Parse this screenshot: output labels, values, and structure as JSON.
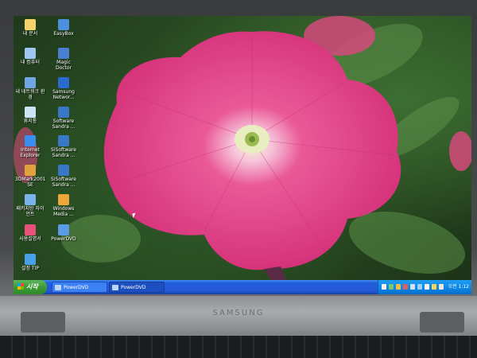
{
  "device": {
    "brand": "SAMSUNG"
  },
  "desktop": {
    "icons": [
      {
        "label": "내 문서",
        "icon": "my-documents-icon",
        "color": "#f5d36a"
      },
      {
        "label": "EasyBox",
        "icon": "easybox-icon",
        "color": "#4f8fe0"
      },
      {
        "label": "내 컴퓨터",
        "icon": "my-computer-icon",
        "color": "#9ec6f0"
      },
      {
        "label": "Magic Doctor",
        "icon": "magic-doctor-icon",
        "color": "#4a7fd2"
      },
      {
        "label": "내 네트워크 환경",
        "icon": "network-places-icon",
        "color": "#6fa7e6"
      },
      {
        "label": "Samsung Networ...",
        "icon": "samsung-network-icon",
        "color": "#2a6bd1"
      },
      {
        "label": "휴지통",
        "icon": "recycle-bin-icon",
        "color": "#cfe3f7"
      },
      {
        "label": "Software Sandra ...",
        "icon": "sandra-icon",
        "color": "#3b77c9"
      },
      {
        "label": "Internet Explorer",
        "icon": "internet-explorer-icon",
        "color": "#3a8ef0"
      },
      {
        "label": "SiSoftware Sandra ...",
        "icon": "sandra-icon",
        "color": "#3b77c9"
      },
      {
        "label": "3DMark2001 SE",
        "icon": "3dmark-icon",
        "color": "#e0a23a"
      },
      {
        "label": "SiSoftware Sandra ...",
        "icon": "sandra-icon",
        "color": "#3b77c9"
      },
      {
        "label": "패키지방 자이언트",
        "icon": "game-icon",
        "color": "#7ab3ea"
      },
      {
        "label": "Windows Media ...",
        "icon": "windows-media-icon",
        "color": "#f0a73a"
      },
      {
        "label": "사용설명서",
        "icon": "manual-icon",
        "color": "#e9507a"
      },
      {
        "label": "PowerDVD",
        "icon": "powerdvd-icon",
        "color": "#5a9be6"
      },
      {
        "label": "설정 TIP",
        "icon": "tip-icon",
        "color": "#4aa0e8"
      }
    ]
  },
  "taskbar": {
    "start_label": "시작",
    "buttons": [
      {
        "label": "PowerDVD",
        "active": false
      },
      {
        "label": "PowerDVD",
        "active": true
      }
    ],
    "clock": "오전 1:12"
  }
}
